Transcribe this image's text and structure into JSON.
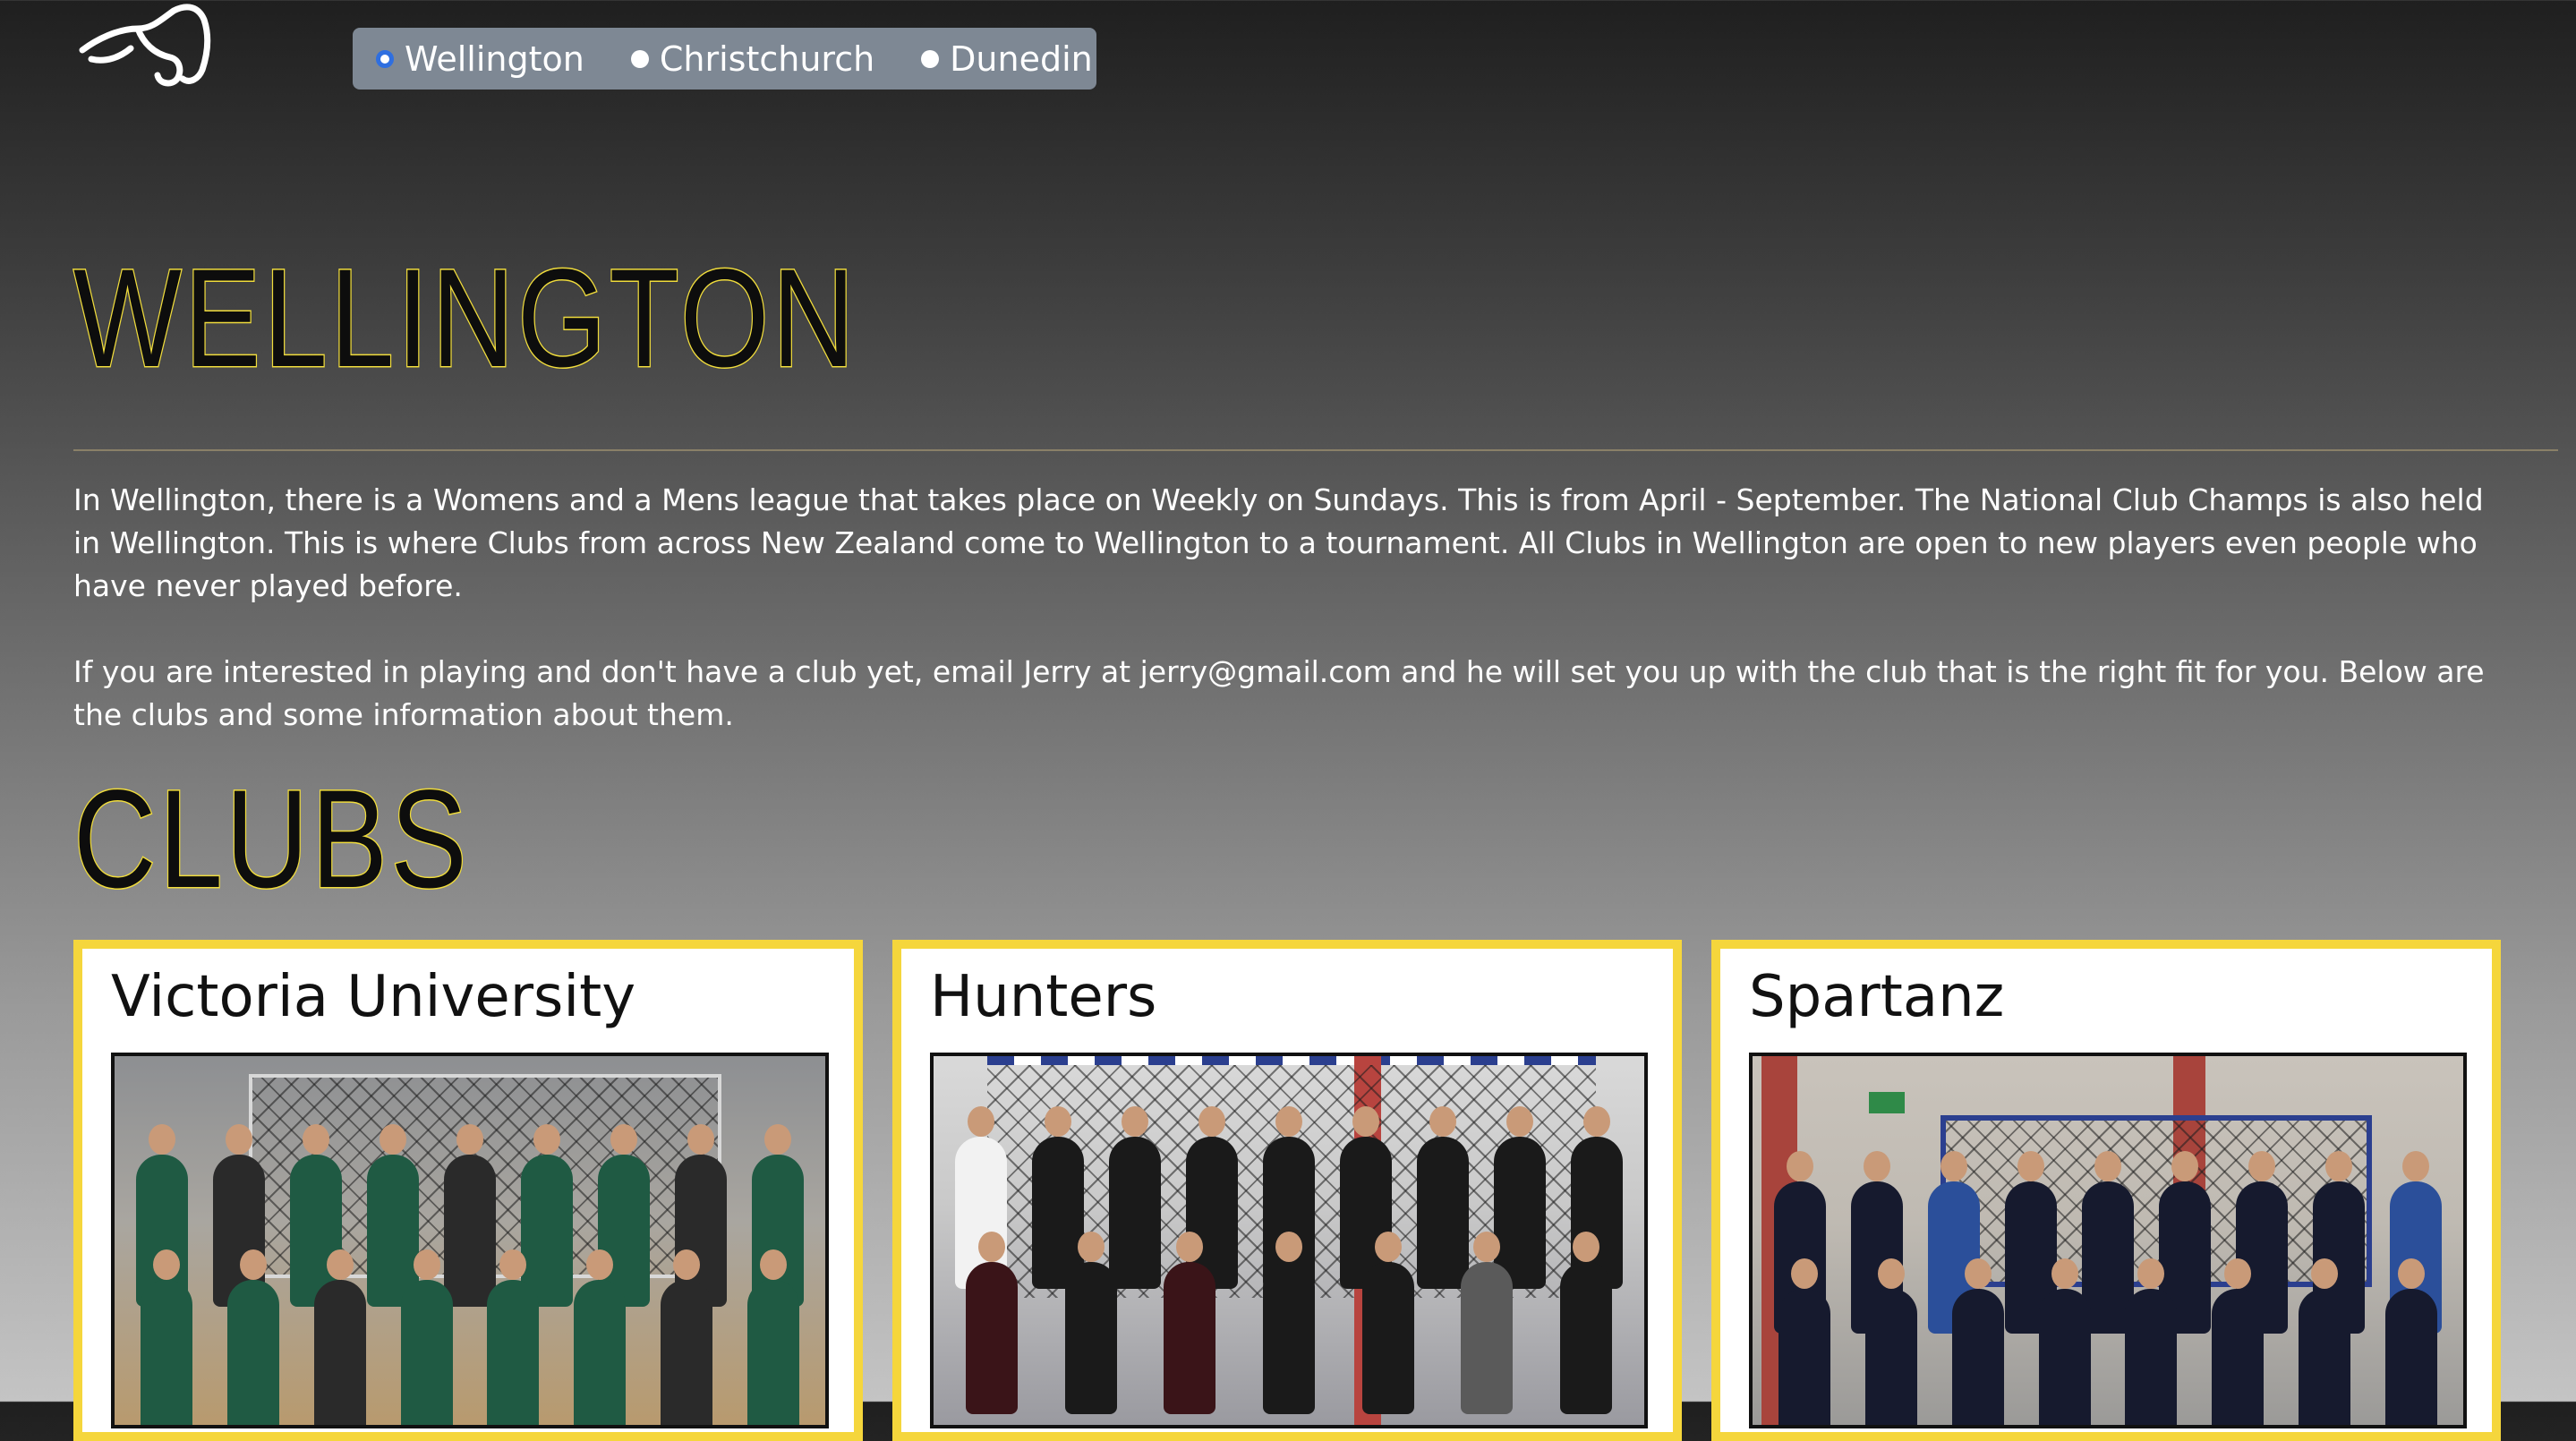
{
  "region_nav": {
    "options": [
      {
        "label": "Wellington",
        "selected": true
      },
      {
        "label": "Christchurch",
        "selected": false
      },
      {
        "label": "Dunedin",
        "selected": false
      }
    ]
  },
  "main": {
    "title": "WELLINGTON",
    "paragraphs": [
      "In Wellington, there is a Womens and a Mens league that takes place on Weekly on Sundays. This is from April - September. The National Club Champs is also held in Wellington. This is where Clubs from across New Zealand come to Wellington to a tournament. All Clubs in Wellington are open to new players even people who have never played before.",
      "If you are interested in playing and don't have a club yet, email Jerry at jerry@gmail.com and he will set you up with the club that is the right fit for you. Below are the clubs and some information about them."
    ]
  },
  "clubs": {
    "title": "CLUBS",
    "items": [
      {
        "name": "Victoria University"
      },
      {
        "name": "Hunters"
      },
      {
        "name": "Spartanz"
      }
    ]
  },
  "colors": {
    "accent_yellow": "#f5d63c",
    "nav_bg": "#7e8894",
    "radio_selected": "#2f6fe0"
  },
  "icons": {
    "logo": "handball-player-logo"
  }
}
